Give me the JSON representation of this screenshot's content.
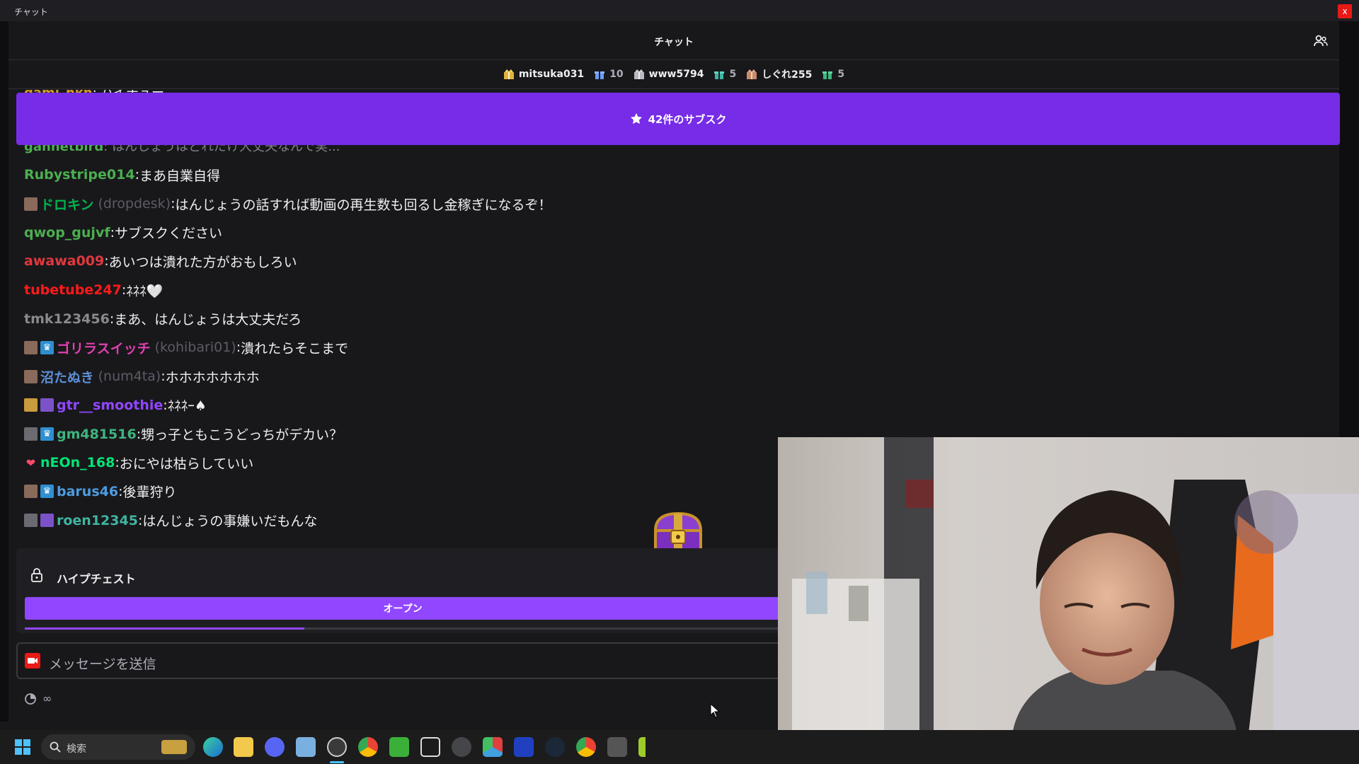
{
  "window": {
    "title": "チャット",
    "close": "x"
  },
  "chat_header": {
    "title": "チャット"
  },
  "leaderboard": [
    {
      "name": "mitsuka031",
      "count": "10"
    },
    {
      "name": "www5794",
      "count": "5"
    },
    {
      "name": "しぐれ255",
      "count": "5"
    }
  ],
  "sub_banner": {
    "label": "42件のサブスク"
  },
  "partial_top": {
    "user": "gaml_nkn",
    "text": "ハイチュー"
  },
  "partial_mid": {
    "user": "gannetbird",
    "text": "はんじょうはどれだけ大丈夫なんで実..."
  },
  "messages": [
    {
      "user": "Rubystripe014",
      "color": "#4caf50",
      "text": "まあ自業自得",
      "login": "",
      "badges": []
    },
    {
      "user": "ドロキン",
      "color": "#00b34d",
      "login": "(dropdesk)",
      "text": "はんじょうの話すれば動画の再生数も回るし金稼ぎになるぞ！",
      "badges": [
        "avatar"
      ]
    },
    {
      "user": "qwop_gujvf",
      "color": "#4caf50",
      "text": "サブスクください",
      "login": "",
      "badges": []
    },
    {
      "user": "awawa009",
      "color": "#e0383e",
      "text": "あいつは潰れた方がおもしろい",
      "login": "",
      "badges": []
    },
    {
      "user": "tubetube247",
      "color": "#ff1a1a",
      "text": "ﾈﾈﾈ🤍",
      "login": "",
      "badges": []
    },
    {
      "user": "tmk123456",
      "color": "#8a8a8a",
      "text": "まあ、はんじょうは大丈夫だろ",
      "login": "",
      "badges": []
    },
    {
      "user": "ゴリラスイッチ",
      "color": "#e040b0",
      "login": "(kohibari01)",
      "text": "潰れたらそこまで",
      "badges": [
        "avatar",
        "crown"
      ]
    },
    {
      "user": "沼たぬき",
      "color": "#5b8fd6",
      "login": "(num4ta)",
      "text": "ホホホホホホホ",
      "badges": [
        "avatar"
      ]
    },
    {
      "user": "gtr__smoothie",
      "color": "#9147ff",
      "text": "ﾈﾈﾈｰ♠",
      "login": "",
      "badges": [
        "gold",
        "purple"
      ]
    },
    {
      "user": "gm481516",
      "color": "#3fb47f",
      "text": "甥っ子ともこうどっちがデカい？",
      "login": "",
      "badges": [
        "gray",
        "crown"
      ]
    },
    {
      "user": "nEOn_168",
      "color": "#00e676",
      "text": "おにやは枯らしていい",
      "login": "",
      "badges": [
        "heart"
      ]
    },
    {
      "user": "barus46",
      "color": "#4d9de0",
      "text": "後輩狩り",
      "login": "",
      "badges": [
        "avatar",
        "crown"
      ]
    },
    {
      "user": "roen12345",
      "color": "#3fb4a0",
      "text": "はんじょうの事嫌いだもんな",
      "login": "",
      "badges": [
        "gray",
        "purple"
      ]
    }
  ],
  "hype_chest": {
    "label": "ハイプチェスト",
    "open_label": "オープン",
    "progress": 0.37
  },
  "input": {
    "placeholder": "メッセージを送信"
  },
  "below_input": {
    "value": "∞"
  },
  "taskbar": {
    "search_label": "検索"
  }
}
